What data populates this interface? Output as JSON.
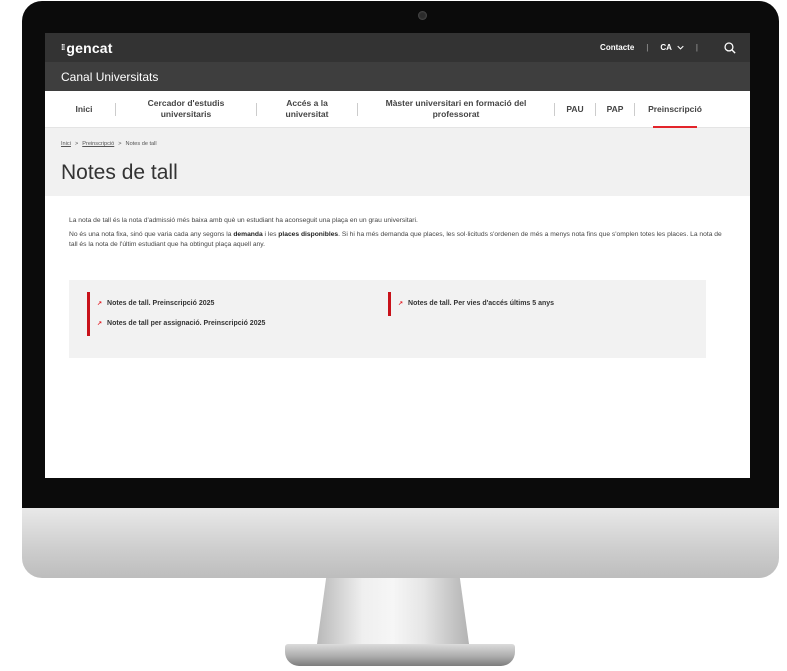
{
  "topbar": {
    "logo_text": "gencat",
    "logo_mark": "⁞⁞",
    "contact_label": "Contacte",
    "language_label": "CA",
    "search_icon": "search-icon"
  },
  "site": {
    "title": "Canal Universitats"
  },
  "nav": {
    "items": [
      {
        "label": "Inici"
      },
      {
        "label": "Cercador d'estudis universitaris"
      },
      {
        "label": "Accés a la universitat"
      },
      {
        "label": "Màster universitari en formació del professorat"
      },
      {
        "label": "PAU"
      },
      {
        "label": "PAP"
      },
      {
        "label": "Preinscripció"
      }
    ],
    "active": "Preinscripció"
  },
  "breadcrumb": {
    "home": "Inici",
    "section": "Preinscripció",
    "current": "Notes de tall"
  },
  "page": {
    "title": "Notes de tall",
    "intro": "La nota de tall és la nota d'admissió més baixa amb què un estudiant ha aconseguit una plaça en un grau universitari.",
    "p2_a": "No és una nota fixa, sinó que varia cada any segons la ",
    "p2_bold1": "demanda",
    "p2_b": " i les ",
    "p2_bold2": "places disponibles",
    "p2_c": ". Si hi ha més demanda que places, les sol·licituds s'ordenen de més a menys nota fins que s'omplen totes les places. La nota de tall és la nota de l'últim estudiant que ha obtingut plaça aquell any."
  },
  "links": {
    "link1": "Notes de tall. Preinscripció 2025",
    "link2": "Notes de tall per assignació. Preinscripció 2025",
    "link3": "Notes de tall. Per vies d'accés últims 5 anys",
    "icon": "external-link-icon"
  },
  "colors": {
    "topbar": "#333333",
    "sitebar": "#3e3e3e",
    "accent": "#e3242b",
    "header_bg": "#f1f1f1",
    "links_bg": "#f2f2f2"
  }
}
